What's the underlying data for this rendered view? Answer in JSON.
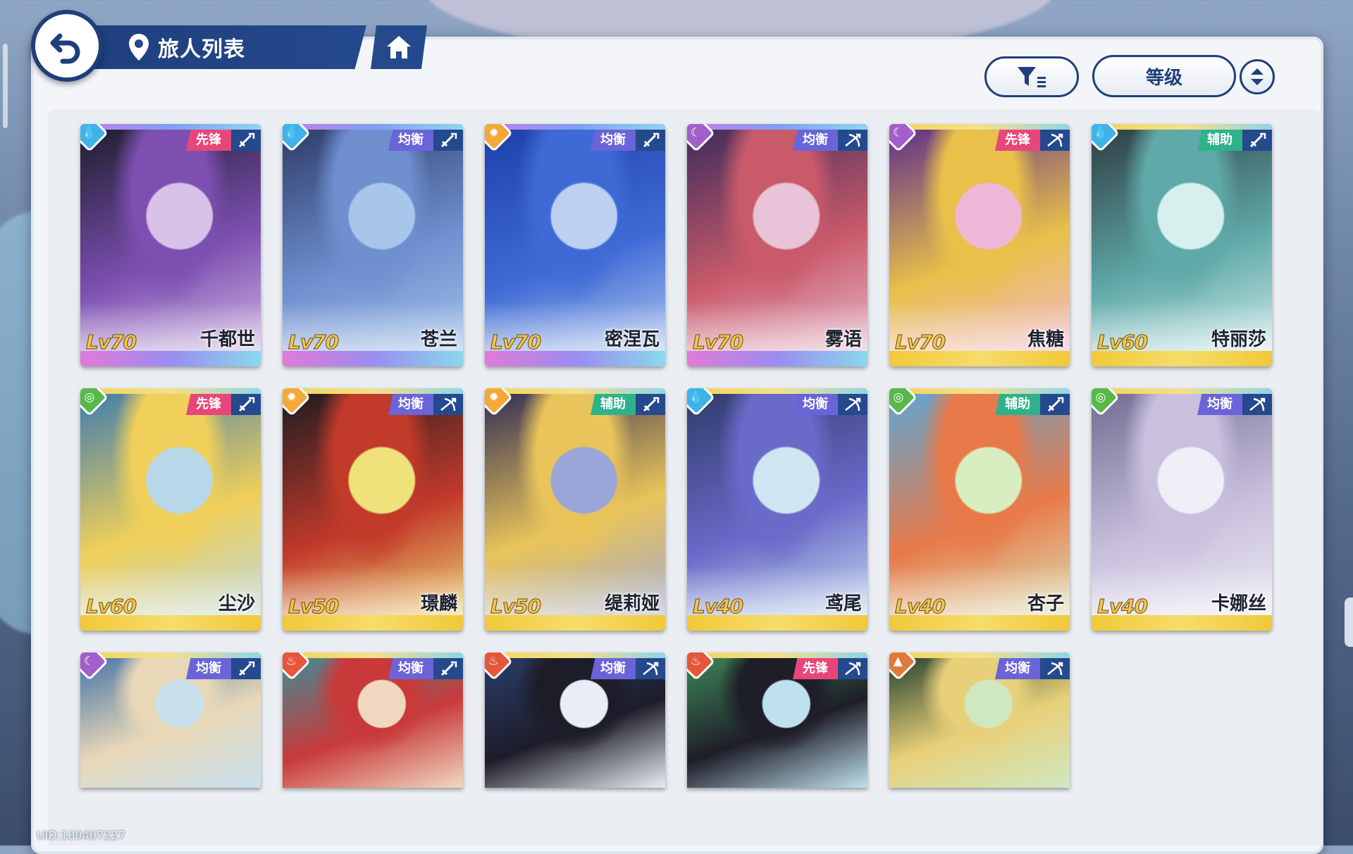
{
  "header": {
    "title": "旅人列表"
  },
  "controls": {
    "sort_label": "等级"
  },
  "footer": {
    "uid": "UID:100407227"
  },
  "colors": {
    "navy": "#1f3f7c",
    "water": "#3fb3e8",
    "light": "#f2a93a",
    "moon": "#a25ec9",
    "wind": "#58b84c",
    "fire": "#e5563a",
    "earth": "#e07a3a",
    "role_vanguard": "#e8467a",
    "role_balance": "#6a64d8",
    "role_support": "#2fb28a"
  },
  "cards": [
    {
      "name": "千都世",
      "level": "Lv70",
      "element": "water",
      "role": "先锋",
      "weapon": "sword",
      "rarity": "purple",
      "art": [
        "#1b1c2a",
        "#7c4fb0",
        "#d8c2e8"
      ]
    },
    {
      "name": "苍兰",
      "level": "Lv70",
      "element": "water",
      "role": "均衡",
      "weapon": "sword",
      "rarity": "purple",
      "art": [
        "#2b3a66",
        "#6f8fcf",
        "#a8c6ea"
      ]
    },
    {
      "name": "密涅瓦",
      "level": "Lv70",
      "element": "light",
      "role": "均衡",
      "weapon": "sword",
      "rarity": "purple",
      "art": [
        "#1c3fa8",
        "#3f6ad6",
        "#bcd0f0"
      ]
    },
    {
      "name": "雾语",
      "level": "Lv70",
      "element": "moon",
      "role": "均衡",
      "weapon": "bow",
      "rarity": "purple",
      "art": [
        "#3a2a5a",
        "#c95a6a",
        "#e9c3d8"
      ]
    },
    {
      "name": "焦糖",
      "level": "Lv70",
      "element": "moon",
      "role": "先锋",
      "weapon": "bow",
      "rarity": "gold",
      "art": [
        "#5b2a8a",
        "#e8c04a",
        "#f0b7d8"
      ]
    },
    {
      "name": "特丽莎",
      "level": "Lv60",
      "element": "water",
      "role": "辅助",
      "weapon": "sword",
      "rarity": "gold",
      "art": [
        "#2d3a40",
        "#5fa9a8",
        "#d7f0ee"
      ]
    },
    {
      "name": "尘沙",
      "level": "Lv60",
      "element": "wind",
      "role": "先锋",
      "weapon": "sword",
      "rarity": "gold",
      "art": [
        "#3a7ab0",
        "#f0d05a",
        "#b8d8ea"
      ]
    },
    {
      "name": "璟麟",
      "level": "Lv50",
      "element": "light",
      "role": "均衡",
      "weapon": "bow",
      "rarity": "gold",
      "art": [
        "#1b1b20",
        "#c23a2a",
        "#f0e27a"
      ]
    },
    {
      "name": "缇莉娅",
      "level": "Lv50",
      "element": "light",
      "role": "辅助",
      "weapon": "sword",
      "rarity": "gold",
      "art": [
        "#2d2a55",
        "#e9c45a",
        "#9aa6d8"
      ]
    },
    {
      "name": "鸢尾",
      "level": "Lv40",
      "element": "water",
      "role": "均衡",
      "weapon": "bow",
      "rarity": "gold",
      "art": [
        "#2f3a6a",
        "#6a6ac8",
        "#cfe6f2"
      ]
    },
    {
      "name": "杏子",
      "level": "Lv40",
      "element": "wind",
      "role": "辅助",
      "weapon": "sword",
      "rarity": "gold",
      "art": [
        "#5aa8d8",
        "#e87a4a",
        "#d8eec0"
      ]
    },
    {
      "name": "卡娜丝",
      "level": "Lv40",
      "element": "wind",
      "role": "均衡",
      "weapon": "bow",
      "rarity": "gold",
      "art": [
        "#6f6a90",
        "#c8c0dc",
        "#f0eef6"
      ]
    },
    {
      "name": "",
      "level": "",
      "element": "moon",
      "role": "均衡",
      "weapon": "sword",
      "rarity": "gold",
      "art": [
        "#3f6fa8",
        "#e8d8b8",
        "#c9e0ee"
      ]
    },
    {
      "name": "",
      "level": "",
      "element": "fire",
      "role": "均衡",
      "weapon": "sword",
      "rarity": "gold",
      "art": [
        "#3a8f9a",
        "#c83a3a",
        "#f0d8c0"
      ]
    },
    {
      "name": "",
      "level": "",
      "element": "fire",
      "role": "均衡",
      "weapon": "bow",
      "rarity": "gold",
      "art": [
        "#2a3f6a",
        "#1d1d2a",
        "#e8eef4"
      ]
    },
    {
      "name": "",
      "level": "",
      "element": "fire",
      "role": "先锋",
      "weapon": "bow",
      "rarity": "gold",
      "art": [
        "#3f8a5a",
        "#1e1e28",
        "#bfe0ee"
      ]
    },
    {
      "name": "",
      "level": "",
      "element": "earth",
      "role": "均衡",
      "weapon": "bow",
      "rarity": "gold",
      "art": [
        "#1e3a2a",
        "#e8d07a",
        "#cfe8c0"
      ]
    }
  ]
}
